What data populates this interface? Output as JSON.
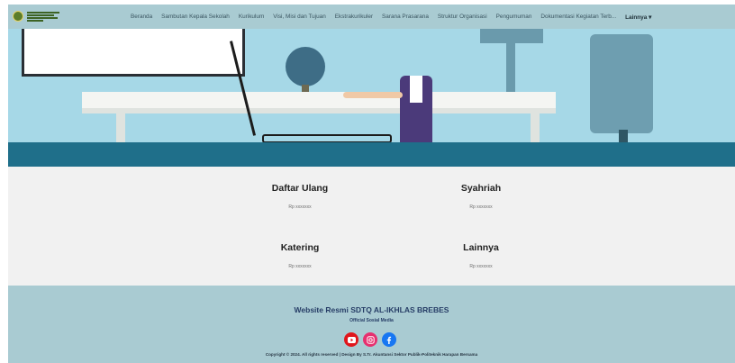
{
  "nav": {
    "items": [
      "Beranda",
      "Sambutan Kepala Sekolah",
      "Kurikulum",
      "Visi, Misi dan Tujuan",
      "Ekstrakurikuler",
      "Sarana Prasarana",
      "Struktur Organisasi",
      "Pengumuman",
      "Dokumentasi Kegiatan Terb..."
    ],
    "more": "Lainnya ▾"
  },
  "fees": [
    {
      "title": "Daftar Ulang",
      "price": "Rp xxxxxxx"
    },
    {
      "title": "Syahriah",
      "price": "Rp xxxxxxx"
    },
    {
      "title": "Katering",
      "price": "Rp xxxxxxx"
    },
    {
      "title": "Lainnya",
      "price": "Rp xxxxxxx"
    }
  ],
  "footer": {
    "title": "Website Resmi SDTQ AL-IKHLAS BREBES",
    "subtitle": "Official Sosial Media",
    "copyright": "Copyright © 2024. All rights reserved | Design By S.Tr. Akuntansi Sektor Publik-Politeknik Harapan Bersama"
  },
  "colors": {
    "nav": "#a9cbd2",
    "hero": "#a6d8e7",
    "band": "#1f6f8a",
    "title_blue": "#263d66"
  },
  "icons": [
    "school-logo-icon",
    "youtube-icon",
    "instagram-icon",
    "facebook-icon"
  ]
}
